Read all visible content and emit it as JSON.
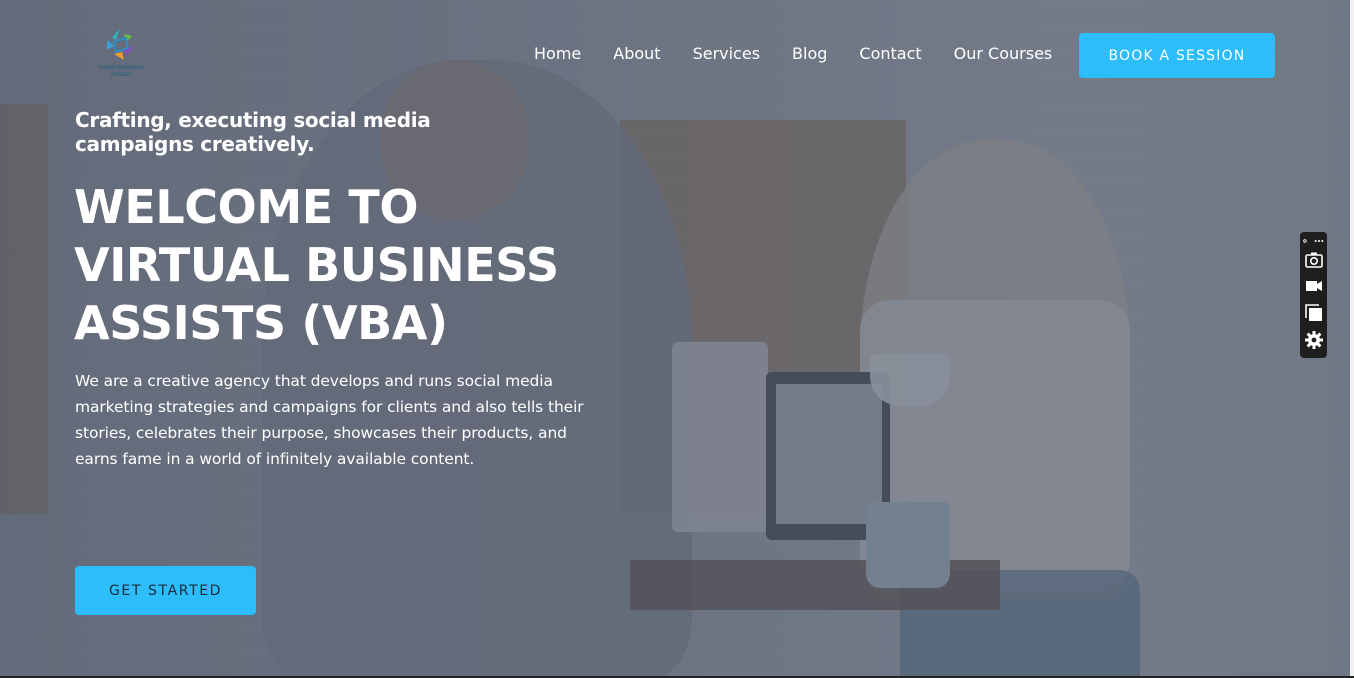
{
  "brand": {
    "logo_text_line1": "Virtual Business",
    "logo_text_line2": "Assists",
    "accent_color": "#2dbdfb"
  },
  "nav": {
    "items": [
      {
        "label": "Home"
      },
      {
        "label": "About"
      },
      {
        "label": "Services"
      },
      {
        "label": "Blog"
      },
      {
        "label": "Contact"
      },
      {
        "label": "Our Courses"
      }
    ],
    "cta_label": "BOOK A SESSION"
  },
  "hero": {
    "tagline": "Crafting, executing social media campaigns creatively.",
    "title": "WELCOME TO VIRTUAL BUSINESS ASSISTS (VBA)",
    "description": "We are a creative agency that develops and runs social media marketing strategies and campaigns for clients and also tells their stories, celebrates their purpose, showcases their products, and earns fame in a world of infinitely available content.",
    "cta_label": "GET STARTED"
  },
  "capture_toolbar": {
    "icons": [
      "pin-icon",
      "more-icon",
      "camera-icon",
      "video-icon",
      "copy-icon",
      "gear-icon"
    ]
  }
}
